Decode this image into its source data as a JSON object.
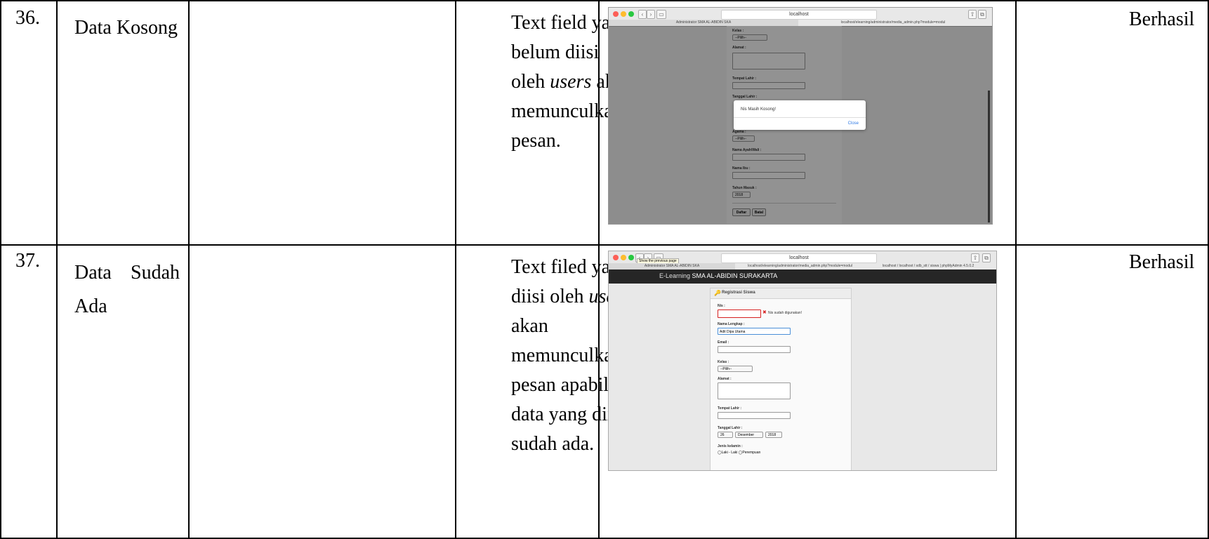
{
  "rows": [
    {
      "no": "36.",
      "scenario": "Data Kosong",
      "description": [
        "Text field yang",
        "belum diisi",
        "oleh users akan",
        "memunculkan",
        "pesan."
      ],
      "result": "Berhasil",
      "shot": {
        "address": "localhost",
        "tab1": "Administrator SMA AL-ABIDIN SKA",
        "tab2": "localhost/elearning/administrator/media_admin.php?module=modul",
        "labels": {
          "kelas": "Kelas :",
          "alamat": "Alamat :",
          "tempat": "Tempat Lahir :",
          "tanggal": "Tanggal Lahir :",
          "agama": "Agama :",
          "ayah": "Nama Ayah/Wali :",
          "ibu": "Nama Ibu :",
          "tahun": "Tahun Masuk :"
        },
        "select_kelas": "--Pilih--",
        "select_agama": "--Pilih--",
        "select_tahun": "2018",
        "btn_daftar": "Daftar",
        "btn_batal": "Batal",
        "alert_message": "Nis Masih Kosong!",
        "alert_close": "Close"
      }
    },
    {
      "no": "37.",
      "scenario": "Data Sudah Ada",
      "description": [
        "Text filed yang",
        "diisi oleh users",
        "akan",
        "memunculkan",
        "pesan apabila",
        "data yang diisi",
        "sudah ada."
      ],
      "result": "Berhasil",
      "shot": {
        "address": "localhost",
        "tooltip": "Show the previous page",
        "tab1": "Administrator SMA AL-ABIDIN SKA",
        "tab2": "localhost/elearning/administrator/media_admin.php?module=modul",
        "tab3": "localhost / localhost / sdb_stt / siswa | phpMyAdmin 4.5.0.2",
        "site_title_prefix": "E-Learning ",
        "site_title": "SMA AL-ABIDIN SURAKARTA",
        "panel_title": "Registrasi Siswa",
        "labels": {
          "nis": "Nis :",
          "nama": "Nama Lengkap :",
          "email": "Email :",
          "kelas": "Kelas :",
          "alamat": "Alamat :",
          "tempat": "Tempat Lahir :",
          "tanggal": "Tanggal Lahir :",
          "jk": "Jenis kelamin :"
        },
        "nis_error": "Nis sudah digunakan!",
        "nama_value": "Adit Dipa Utama",
        "select_kelas": "--Pilih--",
        "tgl_day": "26",
        "tgl_month": "Desember",
        "tgl_year": "2018",
        "jk_male": "Laki - Laki",
        "jk_female": "Perempuan"
      }
    }
  ]
}
